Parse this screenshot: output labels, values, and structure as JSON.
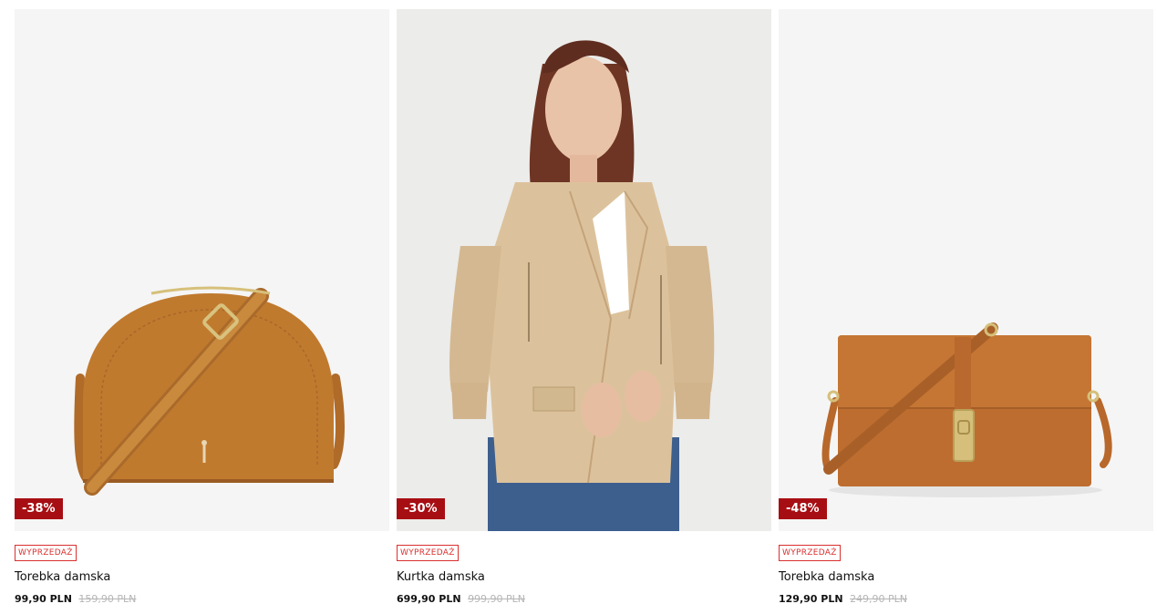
{
  "products": [
    {
      "badge": "WYPRZEDAŻ",
      "discount": "-38%",
      "name": "Torebka damska",
      "price": "99,90 PLN",
      "old_price": "159,90 PLN",
      "image": "half-moon-crossbody-bag"
    },
    {
      "badge": "WYPRZEDAŻ",
      "discount": "-30%",
      "name": "Kurtka damska",
      "price": "699,90 PLN",
      "old_price": "999,90 PLN",
      "image": "beige-leather-biker-jacket-on-model"
    },
    {
      "badge": "WYPRZEDAŻ",
      "discount": "-48%",
      "name": "Torebka damska",
      "price": "129,90 PLN",
      "old_price": "249,90 PLN",
      "image": "flap-crossbody-bag-with-turn-lock"
    }
  ],
  "colors": {
    "sale_badge_bg": "#a70e13",
    "sale_tag": "#d9302f",
    "old_price": "#b5b5b5",
    "bag_tan": "#c07a2e",
    "bag_brown": "#bd6d2f",
    "jacket_beige": "#dcc29c"
  }
}
